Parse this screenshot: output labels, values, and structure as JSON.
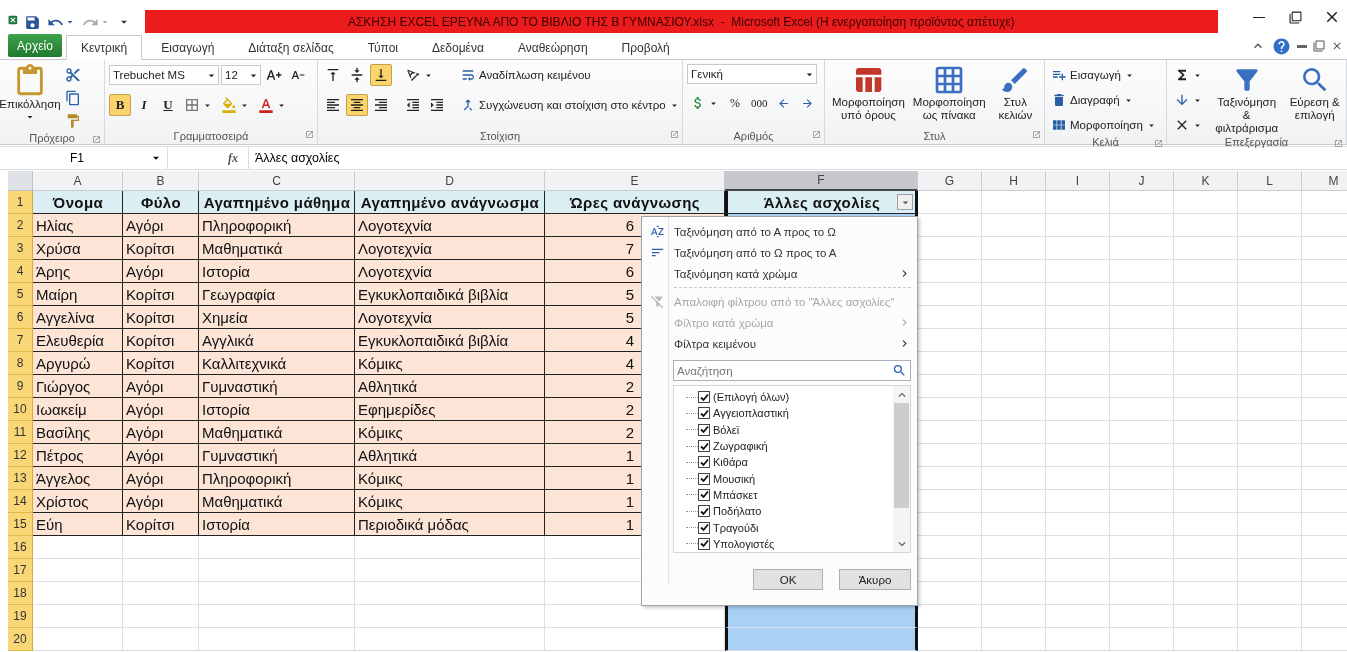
{
  "window": {
    "title": "ΑΣΚΗΣΗ EXCEL ΕΡΕΥΝΑ ΑΠΟ ΤΟ ΒΙΒΛΙΟ ΤΗΣ Β ΓΥΜΝΑΣΙΟΥ.xlsx  -  Microsoft Excel (Η ενεργοποίηση προϊόντος απέτυχε)"
  },
  "ribbon": {
    "file_tab": "Αρχείο",
    "tabs": [
      {
        "label": "Κεντρική",
        "selected": true
      },
      {
        "label": "Εισαγωγή",
        "selected": false
      },
      {
        "label": "Διάταξη σελίδας",
        "selected": false
      },
      {
        "label": "Τύποι",
        "selected": false
      },
      {
        "label": "Δεδομένα",
        "selected": false
      },
      {
        "label": "Αναθεώρηση",
        "selected": false
      },
      {
        "label": "Προβολή",
        "selected": false
      }
    ],
    "clipboard": {
      "paste": "Επικόλληση",
      "group": "Πρόχειρο"
    },
    "font": {
      "name": "Trebuchet MS",
      "size": "12",
      "group": "Γραμματοσειρά",
      "styles": [
        {
          "label": "B",
          "kind": "bold",
          "on": true
        },
        {
          "label": "I",
          "kind": "italic",
          "on": false
        },
        {
          "label": "U",
          "kind": "underline",
          "on": false
        }
      ]
    },
    "alignment": {
      "group": "Στοίχιση",
      "wrap": "Αναδίπλωση κειμένου",
      "merge": "Συγχώνευση και στοίχιση στο κέντρο",
      "vertical": [
        {
          "kind": "top",
          "selected": false
        },
        {
          "kind": "middle",
          "selected": false
        },
        {
          "kind": "bottom",
          "selected": true
        }
      ],
      "horizontal": [
        {
          "kind": "left",
          "selected": false
        },
        {
          "kind": "center",
          "selected": true
        },
        {
          "kind": "right",
          "selected": false
        }
      ]
    },
    "number": {
      "group": "Αριθμός",
      "format": "Γενική",
      "percent": "%",
      "thousands": "000"
    },
    "styles": {
      "group": "Στυλ",
      "buttons": [
        {
          "label": "Μορφοποίηση υπό όρους",
          "kind": "conditional"
        },
        {
          "label": "Μορφοποίηση ως πίνακα",
          "kind": "table"
        },
        {
          "label": "Στυλ κελιών",
          "kind": "cell"
        }
      ]
    },
    "cells": {
      "group": "Κελιά",
      "buttons": [
        {
          "label": "Εισαγωγή",
          "kind": "insert"
        },
        {
          "label": "Διαγραφή",
          "kind": "delete"
        },
        {
          "label": "Μορφοποίηση",
          "kind": "format"
        }
      ]
    },
    "editing": {
      "group": "Επεξεργασία",
      "buttons": [
        {
          "label": "Ταξινόμηση & φιλτράρισμα",
          "kind": "sort"
        },
        {
          "label": "Εύρεση & επιλογή",
          "kind": "find"
        }
      ]
    }
  },
  "formula_bar": {
    "name_box": "F1",
    "function_label": "fx",
    "formula": "Άλλες ασχολίες"
  },
  "sheet": {
    "columns": [
      {
        "label": "A",
        "selected": false
      },
      {
        "label": "B",
        "selected": false
      },
      {
        "label": "C",
        "selected": false
      },
      {
        "label": "D",
        "selected": false
      },
      {
        "label": "E",
        "selected": false
      },
      {
        "label": "F",
        "selected": true
      },
      {
        "label": "G",
        "selected": false
      },
      {
        "label": "H",
        "selected": false
      },
      {
        "label": "I",
        "selected": false
      },
      {
        "label": "J",
        "selected": false
      },
      {
        "label": "K",
        "selected": false
      },
      {
        "label": "L",
        "selected": false
      },
      {
        "label": "M",
        "selected": false
      }
    ],
    "rows": [
      {
        "number": "1",
        "cells": [
          "Όνομα",
          "Φύλο",
          "Αγαπημένο μάθημα",
          "Αγαπημένο ανάγνωσμα",
          "Ώρες ανάγνωσης",
          "Άλλες ασχολίες"
        ]
      },
      {
        "number": "2",
        "cells": [
          "Ηλίας",
          "Αγόρι",
          "Πληροφορική",
          "Λογοτεχνία",
          "6"
        ]
      },
      {
        "number": "3",
        "cells": [
          "Χρύσα",
          "Κορίτσι",
          "Μαθηματικά",
          "Λογοτεχνία",
          "7"
        ]
      },
      {
        "number": "4",
        "cells": [
          "Άρης",
          "Αγόρι",
          "Ιστορία",
          "Λογοτεχνία",
          "6"
        ]
      },
      {
        "number": "5",
        "cells": [
          "Μαίρη",
          "Κορίτσι",
          "Γεωγραφία",
          "Εγκυκλοπαιδικά βιβλία",
          "5"
        ]
      },
      {
        "number": "6",
        "cells": [
          "Αγγελίνα",
          "Κορίτσι",
          "Χημεία",
          "Λογοτεχνία",
          "5"
        ]
      },
      {
        "number": "7",
        "cells": [
          "Ελευθερία",
          "Κορίτσι",
          "Αγγλικά",
          "Εγκυκλοπαιδικά βιβλία",
          "4"
        ]
      },
      {
        "number": "8",
        "cells": [
          "Αργυρώ",
          "Κορίτσι",
          "Καλλιτεχνικά",
          "Κόμικς",
          "4"
        ]
      },
      {
        "number": "9",
        "cells": [
          "Γιώργος",
          "Αγόρι",
          "Γυμναστική",
          "Αθλητικά",
          "2"
        ]
      },
      {
        "number": "10",
        "cells": [
          "Ιωακείμ",
          "Αγόρι",
          "Ιστορία",
          "Εφημερίδες",
          "2"
        ]
      },
      {
        "number": "11",
        "cells": [
          "Βασίλης",
          "Αγόρι",
          "Μαθηματικά",
          "Κόμικς",
          "2"
        ]
      },
      {
        "number": "12",
        "cells": [
          "Πέτρος",
          "Αγόρι",
          "Γυμναστική",
          "Αθλητικά",
          "1"
        ]
      },
      {
        "number": "13",
        "cells": [
          "Άγγελος",
          "Αγόρι",
          "Πληροφορική",
          "Κόμικς",
          "1"
        ]
      },
      {
        "number": "14",
        "cells": [
          "Χρίστος",
          "Αγόρι",
          "Μαθηματικά",
          "Κόμικς",
          "1"
        ]
      },
      {
        "number": "15",
        "cells": [
          "Εύη",
          "Κορίτσι",
          "Ιστορία",
          "Περιοδικά μόδας",
          "1"
        ]
      },
      {
        "number": "16",
        "cells": []
      },
      {
        "number": "17",
        "cells": []
      },
      {
        "number": "18",
        "cells": []
      },
      {
        "number": "19",
        "cells": []
      },
      {
        "number": "20",
        "cells": []
      }
    ]
  },
  "filter_menu": {
    "items": [
      {
        "label": "Ταξινόμηση από το Α προς το Ω",
        "kind": "sort_asc",
        "disabled": false
      },
      {
        "label": "Ταξινόμηση από το Ω προς το Α",
        "kind": "sort_desc",
        "disabled": false
      },
      {
        "label": "Ταξινόμηση κατά χρώμα",
        "kind": "submenu",
        "disabled": false
      },
      {
        "label": "Απαλοιφή φίλτρου από το \"Άλλες ασχολίες\"",
        "kind": "clear_filter",
        "disabled": true
      },
      {
        "label": "Φίλτρο κατά χρώμα",
        "kind": "submenu",
        "disabled": true
      },
      {
        "label": "Φίλτρα κειμένου",
        "kind": "submenu",
        "disabled": false
      }
    ],
    "search": {
      "placeholder": "Αναζήτηση"
    },
    "values": [
      {
        "label": "(Επιλογή όλων)",
        "checked": true
      },
      {
        "label": "Αγγειοπλαστική",
        "checked": true
      },
      {
        "label": "Βόλεϊ",
        "checked": true
      },
      {
        "label": "Ζωγραφική",
        "checked": true
      },
      {
        "label": "Κιθάρα",
        "checked": true
      },
      {
        "label": "Μουσική",
        "checked": true
      },
      {
        "label": "Μπάσκετ",
        "checked": true
      },
      {
        "label": "Ποδήλατο",
        "checked": true
      },
      {
        "label": "Τραγούδι",
        "checked": true
      },
      {
        "label": "Υπολογιστές",
        "checked": true
      }
    ],
    "buttons": [
      "OK",
      "Άκυρο"
    ]
  }
}
